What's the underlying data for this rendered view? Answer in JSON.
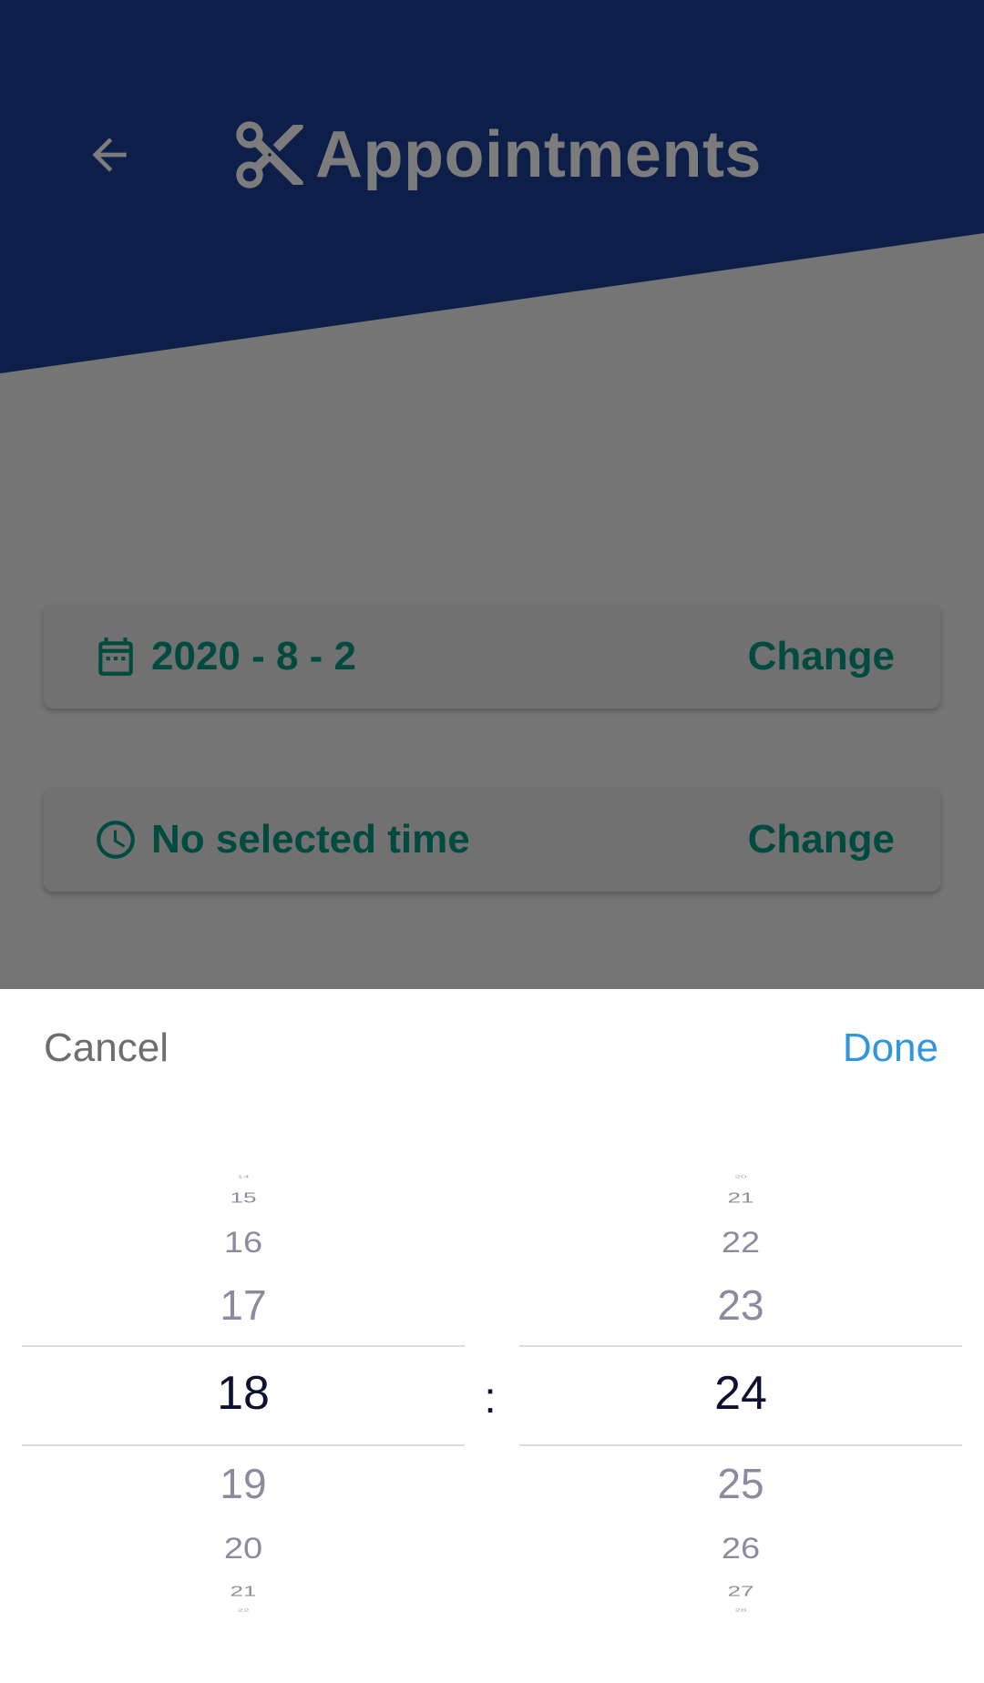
{
  "header": {
    "title": "Appointments",
    "back_icon": "arrow-left-icon",
    "logo_icon": "scissors-icon",
    "background_color": "#0d1e49"
  },
  "date_card": {
    "icon": "calendar-icon",
    "value": "2020 - 8 - 2",
    "change_label": "Change"
  },
  "time_card": {
    "icon": "clock-icon",
    "value": "No selected time",
    "change_label": "Change"
  },
  "picker": {
    "cancel_label": "Cancel",
    "done_label": "Done",
    "separator": ":",
    "hours": {
      "above": [
        "14",
        "15",
        "16",
        "17"
      ],
      "selected": "18",
      "below": [
        "19",
        "20",
        "21",
        "22"
      ]
    },
    "minutes": {
      "above": [
        "20",
        "21",
        "22",
        "23"
      ],
      "selected": "24",
      "below": [
        "25",
        "26",
        "27",
        "28"
      ]
    }
  },
  "colors": {
    "accent_text": "#004a3f",
    "done_blue": "#2f95dc",
    "overlay_gray": "#757575"
  }
}
